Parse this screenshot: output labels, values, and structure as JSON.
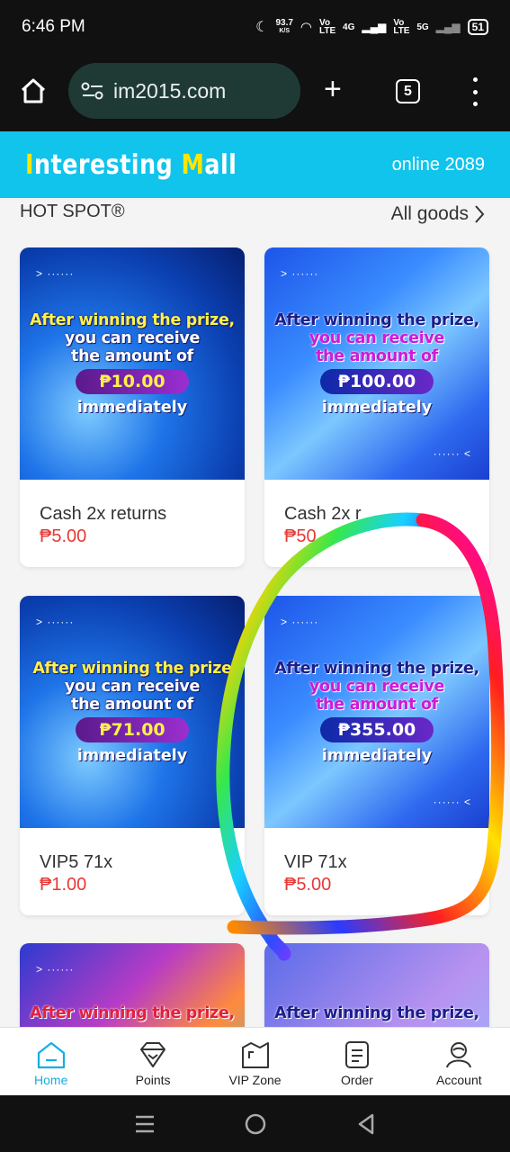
{
  "status": {
    "time": "6:46 PM",
    "speed": "93.7",
    "speed_unit": "K/S",
    "net1": "Vo LTE",
    "net2": "4G",
    "net3": "Vo LTE",
    "net4": "5G",
    "battery": "51"
  },
  "browser": {
    "url": "im2015.com",
    "tab_count": "5"
  },
  "brand": {
    "logo_i": "I",
    "logo_mid": "nteresting ",
    "logo_m": "M",
    "logo_rest": "all",
    "online": "online 2089"
  },
  "section": {
    "title": "HOT SPOT®",
    "all_goods": "All goods"
  },
  "products": [
    {
      "name": "Cash 2x returns",
      "price": "₱5.00",
      "line1": "After winning the prize,",
      "line2": "you can receive",
      "line3": "the amount of",
      "amount": "₱10.00",
      "line4": "immediately"
    },
    {
      "name": "Cash 2x r",
      "price": "₱50",
      "line1": "After winning the prize,",
      "line2": "you can receive",
      "line3": "the amount of",
      "amount": "₱100.00",
      "line4": "immediately"
    },
    {
      "name": "VIP5 71x",
      "price": "₱1.00",
      "line1": "After winning the prize",
      "line2": "you can receive",
      "line3": "the amount of",
      "amount": "₱71.00",
      "line4": "immediately"
    },
    {
      "name": "VIP 71x",
      "price": "₱5.00",
      "line1": "After winning the prize,",
      "line2": "you can receive",
      "line3": "the amount of",
      "amount": "₱355.00",
      "line4": "immediately"
    },
    {
      "line1": "After winning the prize,"
    },
    {
      "line1": "After winning the prize,"
    }
  ],
  "nav": [
    {
      "label": "Home",
      "icon": "home-icon"
    },
    {
      "label": "Points",
      "icon": "diamond-icon"
    },
    {
      "label": "VIP Zone",
      "icon": "vip-zone-icon"
    },
    {
      "label": "Order",
      "icon": "order-icon"
    },
    {
      "label": "Account",
      "icon": "account-icon"
    }
  ],
  "colors": {
    "brand_bar": "#10c4ec",
    "price": "#e53935",
    "active_nav": "#14aee0"
  }
}
